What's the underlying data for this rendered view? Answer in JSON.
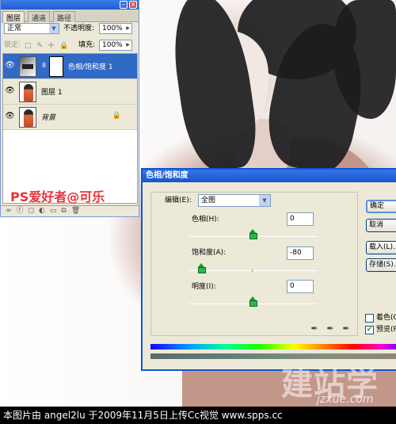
{
  "layers_panel": {
    "tabs": [
      "图层",
      "通道",
      "路径"
    ],
    "blend_mode": "正常",
    "opacity_label": "不透明度:",
    "opacity_value": "100%",
    "lock_label": "锁定:",
    "fill_label": "填充:",
    "fill_value": "100%",
    "layers": [
      {
        "name": "色相/饱和度 1",
        "type": "adjustment",
        "selected": true
      },
      {
        "name": "图层 1",
        "type": "pixel",
        "selected": false
      },
      {
        "name": "背景",
        "type": "background",
        "selected": false,
        "locked": true
      }
    ],
    "watermark": "PS爱好者@可乐",
    "icons": [
      "eye-icon",
      "chain-icon",
      "lock-icon",
      "link-icon",
      "fx-icon",
      "mask-icon",
      "adjustment-icon",
      "folder-icon",
      "new-layer-icon",
      "trash-icon"
    ]
  },
  "dialog": {
    "title": "色相/饱和度",
    "edit_label": "编辑(E):",
    "edit_value": "全图",
    "hue_label": "色相(H):",
    "hue_value": "0",
    "saturation_label": "饱和度(A):",
    "saturation_value": "-80",
    "lightness_label": "明度(I):",
    "lightness_value": "0",
    "slider_range": [
      -100,
      100
    ],
    "hue_slider_value": 0,
    "saturation_slider_value": -80,
    "lightness_slider_value": 0,
    "buttons": {
      "ok": "确定",
      "cancel": "取消",
      "load": "载入(L)...",
      "save": "存储(S)..."
    },
    "colorize_label": "着色(O)",
    "colorize_checked": false,
    "preview_label": "预览(P)",
    "preview_checked": true
  },
  "watermarks": {
    "logo": "建站学",
    "sub": "jzxue.com"
  },
  "caption": "本图片由 angel2lu 于2009年11月5日上传Cc视觉 www.spps.cc",
  "colors": {
    "titlebar_blue": "#1f5ccf",
    "selection_blue": "#316ac5",
    "panel_bg": "#ece9d8",
    "watermark_red": "#e8333b"
  }
}
